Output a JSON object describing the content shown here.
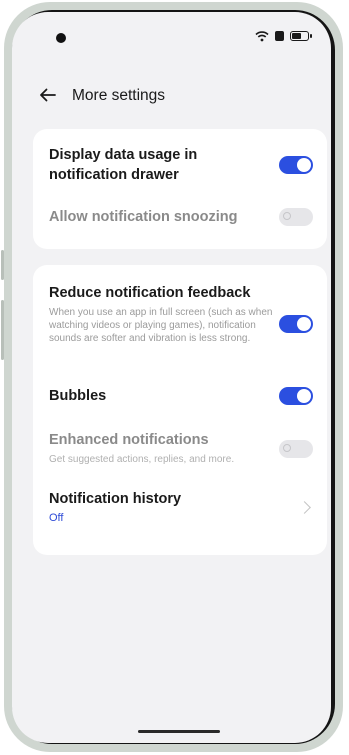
{
  "header": {
    "title": "More settings"
  },
  "icons": {
    "back": "back-arrow-icon",
    "wifi": "wifi-icon",
    "sim": "sim-icon",
    "battery": "battery-icon",
    "chevron": "chevron-right-icon"
  },
  "colors": {
    "accent": "#2b4fe0",
    "value_text": "#2d4ad6",
    "background": "#f2f2f4"
  },
  "card1": {
    "items": [
      {
        "title": "Display data usage in notification drawer",
        "toggle": "on"
      },
      {
        "title": "Allow notification snoozing",
        "toggle": "off"
      }
    ]
  },
  "card2": {
    "items": [
      {
        "title": "Reduce notification feedback",
        "description": "When you use an app in full screen (such as when watching videos or playing games), notification sounds are softer and vibration is less strong.",
        "toggle": "on"
      },
      {
        "title": "Bubbles",
        "toggle": "on"
      },
      {
        "title": "Enhanced notifications",
        "description": "Get suggested actions, replies, and more.",
        "toggle": "off"
      },
      {
        "title": "Notification history",
        "value": "Off"
      }
    ]
  }
}
